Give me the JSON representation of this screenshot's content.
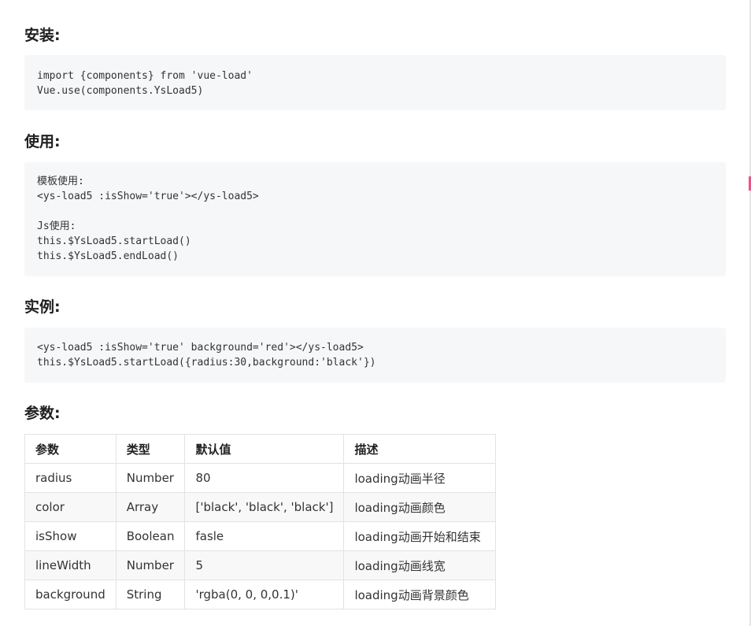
{
  "sections": {
    "install": {
      "title": "安装:",
      "code": "import {components} from 'vue-load'\nVue.use(components.YsLoad5)"
    },
    "usage": {
      "title": "使用:",
      "code": "模板使用:\n<ys-load5 :isShow='true'></ys-load5>\n\nJs使用:\nthis.$YsLoad5.startLoad()\nthis.$YsLoad5.endLoad()"
    },
    "example": {
      "title": "实例:",
      "code": "<ys-load5 :isShow='true' background='red'></ys-load5>\nthis.$YsLoad5.startLoad({radius:30,background:'black'})"
    },
    "params": {
      "title": "参数:"
    }
  },
  "table": {
    "headers": [
      "参数",
      "类型",
      "默认值",
      "描述"
    ],
    "rows": [
      [
        "radius",
        "Number",
        "80",
        "loading动画半径"
      ],
      [
        "color",
        "Array",
        "['black', 'black', 'black']",
        "loading动画颜色"
      ],
      [
        "isShow",
        "Boolean",
        "fasle",
        "loading动画开始和结束"
      ],
      [
        "lineWidth",
        "Number",
        "5",
        "loading动画线宽"
      ],
      [
        "background",
        "String",
        "'rgba(0, 0, 0,0.1)'",
        "loading动画背景颜色"
      ]
    ]
  }
}
